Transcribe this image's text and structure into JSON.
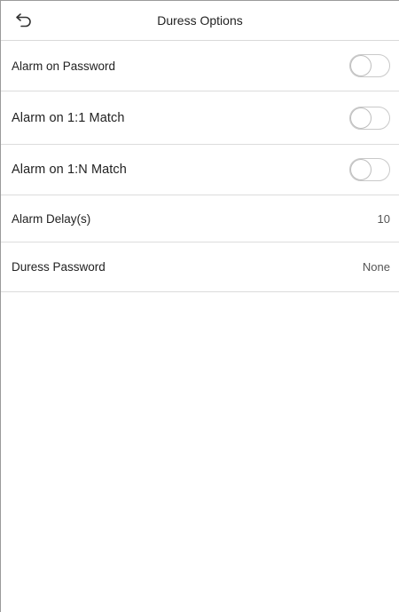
{
  "header": {
    "title": "Duress Options",
    "back_icon": "back-arrow-icon"
  },
  "options": [
    {
      "label": "Alarm on Password",
      "type": "toggle",
      "enabled": false
    },
    {
      "label": "Alarm on 1:1 Match",
      "type": "toggle",
      "enabled": false
    },
    {
      "label": "Alarm on 1:N Match",
      "type": "toggle",
      "enabled": false
    },
    {
      "label": "Alarm Delay(s)",
      "type": "value",
      "value": "10"
    },
    {
      "label": "Duress Password",
      "type": "value",
      "value": "None"
    }
  ],
  "colors": {
    "divider": "#dcdcdc",
    "toggle_border": "#c9c9c9"
  }
}
